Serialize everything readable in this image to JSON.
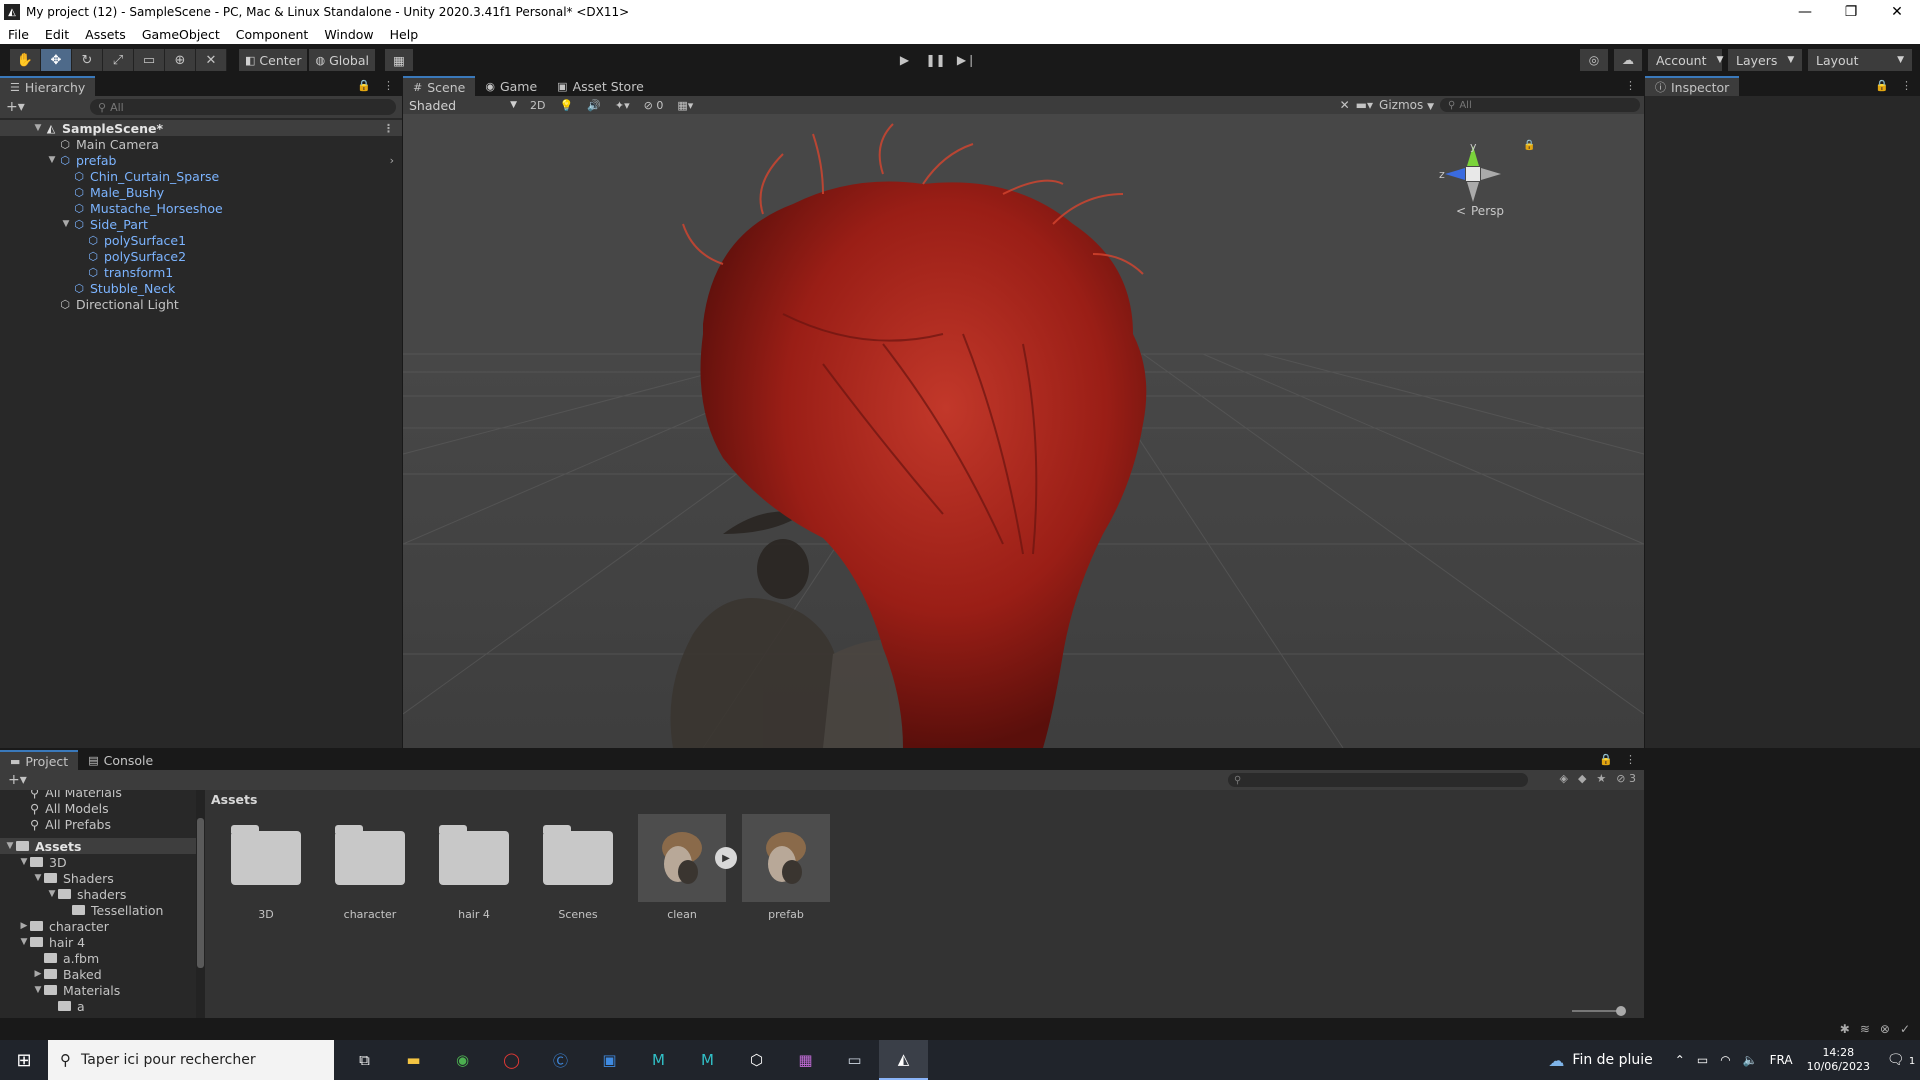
{
  "window": {
    "title": "My project (12) - SampleScene - PC, Mac & Linux Standalone - Unity 2020.3.41f1 Personal* <DX11>",
    "controls": [
      "—",
      "❐",
      "✕"
    ]
  },
  "menu": [
    "File",
    "Edit",
    "Assets",
    "GameObject",
    "Component",
    "Window",
    "Help"
  ],
  "toolbar": {
    "pivot_label": "Center",
    "space_label": "Global",
    "account_label": "Account",
    "layers_label": "Layers",
    "layout_label": "Layout"
  },
  "hierarchy": {
    "tab_label": "Hierarchy",
    "search_placeholder": "All",
    "scene_name": "SampleScene*",
    "items": [
      {
        "label": "Main Camera",
        "depth": 1,
        "blue": false,
        "expand": ""
      },
      {
        "label": "prefab",
        "depth": 1,
        "blue": true,
        "expand": "▼"
      },
      {
        "label": "Chin_Curtain_Sparse",
        "depth": 2,
        "blue": true,
        "expand": ""
      },
      {
        "label": "Male_Bushy",
        "depth": 2,
        "blue": true,
        "expand": ""
      },
      {
        "label": "Mustache_Horseshoe",
        "depth": 2,
        "blue": true,
        "expand": ""
      },
      {
        "label": "Side_Part",
        "depth": 2,
        "blue": true,
        "expand": "▼"
      },
      {
        "label": "polySurface1",
        "depth": 3,
        "blue": true,
        "expand": ""
      },
      {
        "label": "polySurface2",
        "depth": 3,
        "blue": true,
        "expand": ""
      },
      {
        "label": "transform1",
        "depth": 3,
        "blue": true,
        "expand": ""
      },
      {
        "label": "Stubble_Neck",
        "depth": 2,
        "blue": true,
        "expand": ""
      },
      {
        "label": "Directional Light",
        "depth": 1,
        "blue": false,
        "expand": ""
      }
    ]
  },
  "scene": {
    "tabs": [
      {
        "label": "Scene",
        "icon": "#",
        "active": true
      },
      {
        "label": "Game",
        "icon": "◉",
        "active": false
      },
      {
        "label": "Asset Store",
        "icon": "🛍",
        "active": false
      }
    ],
    "shading_mode": "Shaded",
    "mode_2d": "2D",
    "hidden_count": "0",
    "gizmos_label": "Gizmos",
    "search_placeholder": "All",
    "persp_label": "Persp",
    "axis_labels": {
      "y": "y",
      "z": "z"
    }
  },
  "inspector": {
    "tab_label": "Inspector"
  },
  "project": {
    "tabs": [
      {
        "label": "Project",
        "active": true
      },
      {
        "label": "Console",
        "active": false
      }
    ],
    "hidden_count": "3",
    "breadcrumb": "Assets",
    "favorites": [
      "All Materials",
      "All Models",
      "All Prefabs"
    ],
    "tree": [
      {
        "label": "Assets",
        "depth": 0,
        "expand": "▼",
        "bold": true
      },
      {
        "label": "3D",
        "depth": 1,
        "expand": "▼",
        "bold": false
      },
      {
        "label": "Shaders",
        "depth": 2,
        "expand": "▼",
        "bold": false
      },
      {
        "label": "shaders",
        "depth": 3,
        "expand": "▼",
        "bold": false
      },
      {
        "label": "Tessellation",
        "depth": 4,
        "expand": "",
        "bold": false
      },
      {
        "label": "character",
        "depth": 1,
        "expand": "▶",
        "bold": false
      },
      {
        "label": "hair 4",
        "depth": 1,
        "expand": "▼",
        "bold": false
      },
      {
        "label": "a.fbm",
        "depth": 2,
        "expand": "",
        "bold": false
      },
      {
        "label": "Baked",
        "depth": 2,
        "expand": "▶",
        "bold": false
      },
      {
        "label": "Materials",
        "depth": 2,
        "expand": "▼",
        "bold": false
      },
      {
        "label": "a",
        "depth": 3,
        "expand": "",
        "bold": false
      }
    ],
    "assets": [
      {
        "label": "3D",
        "kind": "folder"
      },
      {
        "label": "character",
        "kind": "folder"
      },
      {
        "label": "hair 4",
        "kind": "folder"
      },
      {
        "label": "Scenes",
        "kind": "folder"
      },
      {
        "label": "clean",
        "kind": "model"
      },
      {
        "label": "prefab",
        "kind": "prefab"
      }
    ]
  },
  "taskbar": {
    "search_placeholder": "Taper ici pour rechercher",
    "weather": "Fin de pluie",
    "language": "FRA",
    "time": "14:28",
    "date": "10/06/2023",
    "notifications": "1"
  }
}
